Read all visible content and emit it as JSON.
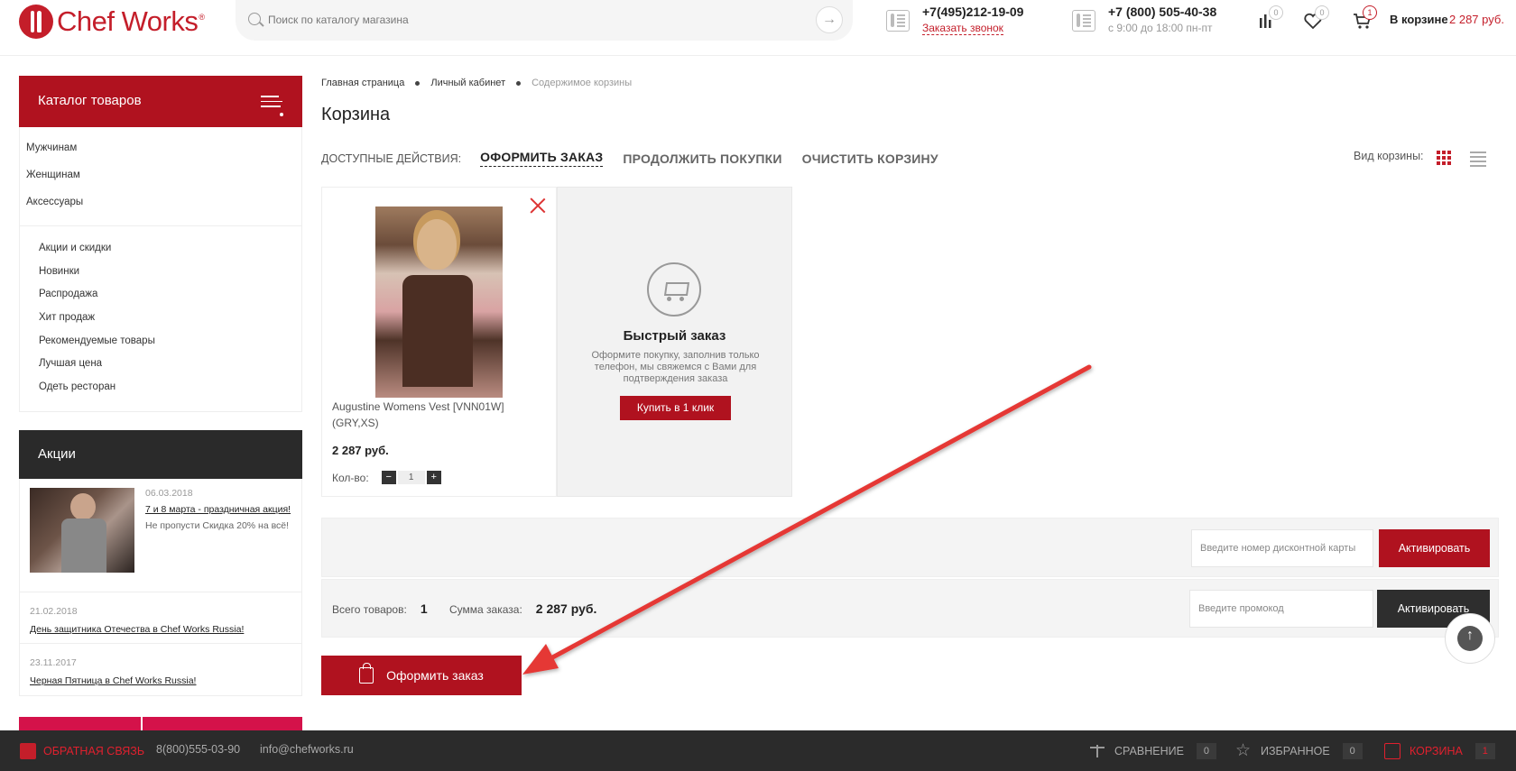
{
  "header": {
    "logo_text": "Chef Works",
    "logo_reg": "®",
    "search_placeholder": "Поиск по каталогу магазина",
    "search_go": "→",
    "phone1": "+7(495)212-19-09",
    "phone1_sub": "Заказать звонок",
    "phone2": "+7 (800) 505-40-38",
    "phone2_sub": "с 9:00 до 18:00 пн-пт",
    "compare_count": "0",
    "favorites_count": "0",
    "cart_count": "1",
    "cart_label": "В корзине",
    "cart_sum": "2 287 руб."
  },
  "sidebar": {
    "catalog_title": "Каталог товаров",
    "main_items": [
      "Мужчинам",
      "Женщинам",
      "Аксессуары"
    ],
    "sub_items": [
      "Акции и скидки",
      "Новинки",
      "Распродажа",
      "Хит продаж",
      "Рекомендуемые товары",
      "Лучшая цена",
      "Одеть ресторан"
    ],
    "promo_title": "Акции",
    "promos": [
      {
        "date": "06.03.2018",
        "link": "7 и 8 марта - праздничная акция!",
        "text": "Не пропусти Скидка 20% на всё!"
      },
      {
        "date": "21.02.2018",
        "link": "День защитника Отечества в Chef Works Russia!"
      },
      {
        "date": "23.11.2017",
        "link": "Черная Пятница в Chef Works Russia!"
      }
    ]
  },
  "main": {
    "breadcrumb": [
      "Главная страница",
      "Личный кабинет",
      "Содержимое корзины"
    ],
    "title": "Корзина",
    "actions_label": "ДОСТУПНЫЕ ДЕЙСТВИЯ:",
    "action_checkout": "ОФОРМИТЬ ЗАКАЗ",
    "action_continue": "ПРОДОЛЖИТЬ ПОКУПКИ",
    "action_clear": "ОЧИСТИТЬ КОРЗИНУ",
    "view_label": "Вид корзины:",
    "product": {
      "name": "Augustine Womens Vest [VNN01W] (GRY,XS)",
      "price": "2 287 руб.",
      "qty_label": "Кол-во:",
      "qty_minus": "−",
      "qty_value": "1",
      "qty_plus": "+"
    },
    "quick": {
      "title": "Быстрый заказ",
      "desc": "Оформите покупку, заполнив только телефон, мы свяжемся с Вами для подтверждения заказа",
      "button": "Купить в 1 клик"
    },
    "discount_placeholder": "Введите номер дисконтной карты",
    "discount_button": "Активировать",
    "total_items_label": "Всего товаров:",
    "total_items": "1",
    "total_sum_label": "Сумма заказа:",
    "total_sum": "2 287 руб.",
    "promo_placeholder": "Введите промокод",
    "promo_button": "Активировать",
    "checkout_button": "Оформить заказ"
  },
  "footer": {
    "feedback": "ОБРАТНАЯ СВЯЗЬ",
    "phone": "8(800)555-03-90",
    "email": "info@chefworks.ru",
    "compare": "СРАВНЕНИЕ",
    "compare_count": "0",
    "favorites": "ИЗБРАННОЕ",
    "favorites_count": "0",
    "cart": "КОРЗИНА",
    "cart_count": "1"
  },
  "colors": {
    "accent": "#b0121f",
    "annotation_arrow": "#e53935",
    "dark": "#2b2b2b"
  }
}
